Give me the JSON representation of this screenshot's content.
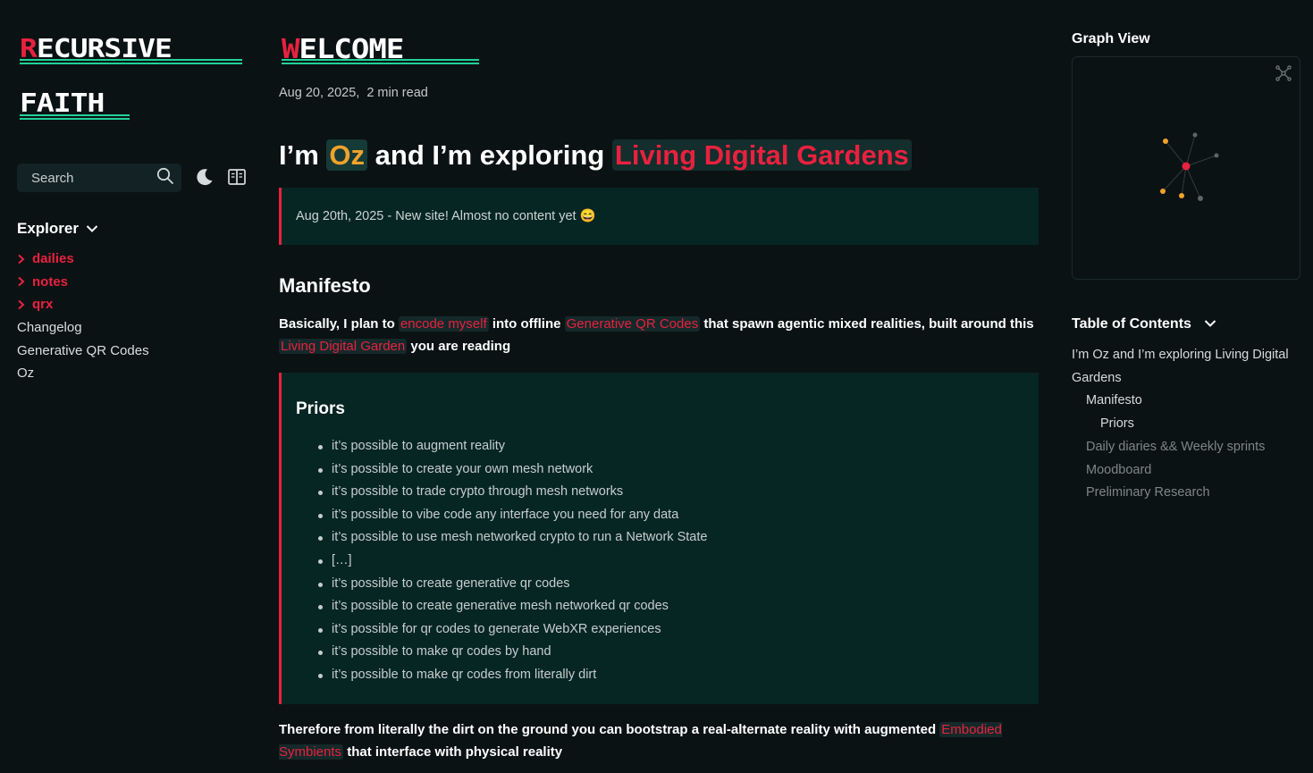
{
  "site": {
    "logo_line1_first": "R",
    "logo_line1_rest": "ECURSIVE",
    "logo_line2_first": "F",
    "logo_line2_rest": "AITH"
  },
  "sidebar": {
    "search_placeholder": "Search",
    "explorer_label": "Explorer",
    "tree": [
      {
        "label": "dailies",
        "type": "folder"
      },
      {
        "label": "notes",
        "type": "folder"
      },
      {
        "label": "qrx",
        "type": "folder"
      },
      {
        "label": "Changelog",
        "type": "file"
      },
      {
        "label": "Generative QR Codes",
        "type": "file"
      },
      {
        "label": "Oz",
        "type": "file"
      }
    ]
  },
  "article": {
    "title_first": "W",
    "title_rest": "ELCOME",
    "date": "Aug 20, 2025,",
    "read_time": "2 min read",
    "heading_pre": "I’m ",
    "heading_oz": "Oz",
    "heading_mid": " and I’m exploring ",
    "heading_garden": "Living Digital Gardens",
    "callout_text": "Aug 20th, 2025 - New site! Almost no content yet 😄",
    "manifesto_heading": "Manifesto",
    "manifesto": {
      "t1": "Basically, I plan to ",
      "link1": "encode myself",
      "t2": " into offline ",
      "link2": "Generative QR Codes",
      "t3": " that spawn agentic mixed realities, built around this ",
      "link3": "Living Digital Garden",
      "t4": " you are reading"
    },
    "priors_title": "Priors",
    "priors": [
      "it’s possible to augment reality",
      "it’s possible to create your own mesh network",
      "it’s possible to trade crypto through mesh networks",
      "it’s possible to vibe code any interface you need for any data",
      "it’s possible to use mesh networked crypto to run a Network State",
      "[…]",
      "it’s possible to create generative qr codes",
      "it’s possible to create generative mesh networked qr codes",
      "it’s possible for qr codes to generate WebXR experiences",
      "it’s possible to make qr codes by hand",
      "it’s possible to make qr codes from literally dirt"
    ],
    "closing": {
      "t1": "Therefore from literally the dirt on the ground you can bootstrap a real-alternate reality with augmented ",
      "link": "Embodied Symbients",
      "t2": " that interface with physical reality"
    }
  },
  "right": {
    "graph_title": "Graph View",
    "graph_colors": {
      "current": "#e8213f",
      "visited": "#f0a22a",
      "other": "#5d6565",
      "edge": "#2f3b3b"
    },
    "toc_title": "Table of Contents",
    "toc": [
      {
        "label": "I’m Oz and I’m exploring Living Digital Gardens",
        "depth": 0,
        "dim": false
      },
      {
        "label": "Manifesto",
        "depth": 1,
        "dim": false
      },
      {
        "label": "Priors",
        "depth": 2,
        "dim": false
      },
      {
        "label": "Daily diaries && Weekly sprints",
        "depth": 1,
        "dim": true
      },
      {
        "label": "Moodboard",
        "depth": 1,
        "dim": true
      },
      {
        "label": "Preliminary Research",
        "depth": 1,
        "dim": true
      }
    ]
  },
  "colors": {
    "background": "#0b1214",
    "accent_red": "#e8213f",
    "accent_orange": "#f0a22a",
    "accent_green": "#21d198",
    "callout_bg": "#062624"
  }
}
